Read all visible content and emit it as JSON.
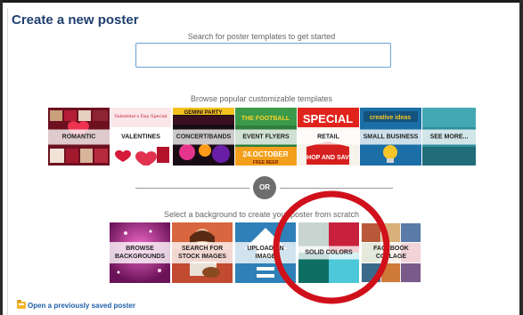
{
  "header": {
    "title": "Create a new poster"
  },
  "search": {
    "caption": "Search for poster templates to get started",
    "value": "",
    "placeholder": ""
  },
  "templates": {
    "caption": "Browse popular customizable templates",
    "items": [
      {
        "label": "ROMANTIC",
        "art": "hearts-collage"
      },
      {
        "label": "VALENTINES",
        "art": "valentines",
        "art_text": "Valentine's Day Special"
      },
      {
        "label": "CONCERT/BANDS",
        "art": "concert",
        "art_text": "GEMINI PARTY"
      },
      {
        "label": "EVENT FLYERS",
        "art": "event",
        "art_text_top": "THE FOOTBALL",
        "art_text_bottom": "24.OCTOBER",
        "art_text_sub": "FREE BEER"
      },
      {
        "label": "RETAIL",
        "art": "retail",
        "art_text_top": "SPECIAL",
        "art_text_bottom": "SHOP AND SAVE"
      },
      {
        "label": "SMALL BUSINESS",
        "art": "business",
        "art_text": "creative ideas"
      },
      {
        "label": "SEE MORE...",
        "art": "teal-blocks"
      }
    ]
  },
  "divider": {
    "label": "OR"
  },
  "backgrounds": {
    "caption": "Select a background to create your poster from scratch",
    "items": [
      {
        "label": "BROWSE BACKGROUNDS",
        "line1": "BROWSE",
        "line2": "BACKGROUNDS",
        "art": "pink-sparkle"
      },
      {
        "label": "SEARCH FOR STOCK IMAGES",
        "line1": "SEARCH FOR",
        "line2": "STOCK IMAGES",
        "art": "guitar-photo"
      },
      {
        "label": "UPLOAD AN IMAGE",
        "line1": "UPLOAD AN IMAGE",
        "line2": "",
        "art": "upload-arrow"
      },
      {
        "label": "SOLID COLORS",
        "line1": "SOLID COLORS",
        "line2": "",
        "art": "color-swatches"
      },
      {
        "label": "FACEBOOK COLLAGE",
        "line1": "FACEBOOK",
        "line2": "COLLAGE",
        "art": "photo-collage"
      }
    ]
  },
  "footer": {
    "link": "Open a previously saved poster",
    "icon": "folder-icon"
  },
  "colors": {
    "title": "#1f3f6e",
    "link": "#1f5fa8",
    "annotation": "#d0101a",
    "search_border": "#6fa6d6"
  }
}
